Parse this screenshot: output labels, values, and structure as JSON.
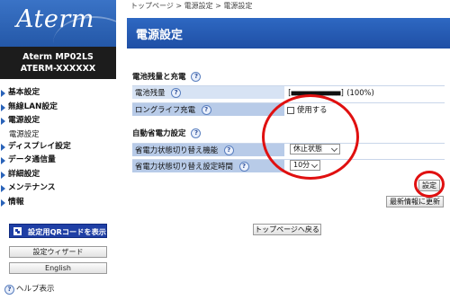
{
  "sidebar": {
    "logo": "Aterm",
    "model_line1": "Aterm MP02LS",
    "model_line2": "ATERM-XXXXXX",
    "nav": [
      {
        "label": "基本設定"
      },
      {
        "label": "無線LAN設定"
      },
      {
        "label": "電源設定"
      },
      {
        "label": "電源設定",
        "sub": true
      },
      {
        "label": "ディスプレイ設定"
      },
      {
        "label": "データ通信量"
      },
      {
        "label": "詳細設定"
      },
      {
        "label": "メンテナンス"
      },
      {
        "label": "情報"
      }
    ],
    "qr_button": "設定用QRコードを表示",
    "wizard_button": "設定ウィザード",
    "english_button": "English",
    "help_label": "ヘルプ表示"
  },
  "main": {
    "breadcrumb": "トップページ > 電源設定 > 電源設定",
    "title": "電源設定",
    "section1": {
      "heading": "電池残量と充電",
      "battery_label": "電池残量",
      "battery_bar": "[■■■■■■■■■■■■]",
      "battery_percent": "(100%)",
      "longlife_label": "ロングライフ充電",
      "longlife_option": "使用する",
      "longlife_checked": false
    },
    "section2": {
      "heading": "自動省電力設定",
      "switch_label": "省電力状態切り替え機能",
      "switch_value": "休止状態",
      "time_label": "省電力状態切り替え設定時間",
      "time_value": "10分"
    },
    "set_button": "設定",
    "refresh_button": "最新情報に更新",
    "top_button": "トップページへ戻る",
    "help_glyph": "?"
  },
  "colors": {
    "header_blue": "#2458a8",
    "row_label_bg": "#d7e3f4",
    "annotation_red": "#e01010",
    "qr_button_bg": "#1f3fa5"
  }
}
